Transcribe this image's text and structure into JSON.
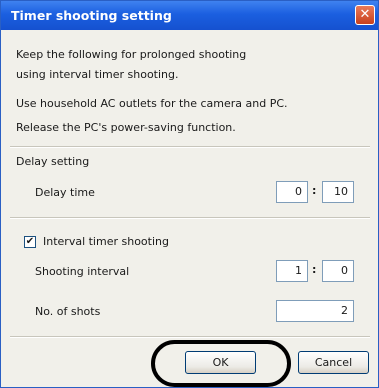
{
  "dialog": {
    "title": "Timer shooting setting",
    "close_glyph": "✕",
    "intro_line1": "Keep the following for prolonged shooting",
    "intro_line2": "using interval timer shooting.",
    "intro_line3": "Use household AC outlets for the camera and PC.",
    "intro_line4": "Release the PC's power-saving function."
  },
  "delay": {
    "section_label": "Delay setting",
    "time_label": "Delay time",
    "minutes": "0",
    "seconds": "10",
    "separator": ":"
  },
  "interval": {
    "checkbox_label": "Interval timer shooting",
    "checked": true,
    "check_glyph": "✔",
    "interval_label": "Shooting interval",
    "minutes": "1",
    "seconds": "0",
    "separator": ":",
    "shots_label": "No. of shots",
    "shots_value": "2"
  },
  "buttons": {
    "ok_label": "OK",
    "cancel_label": "Cancel"
  }
}
